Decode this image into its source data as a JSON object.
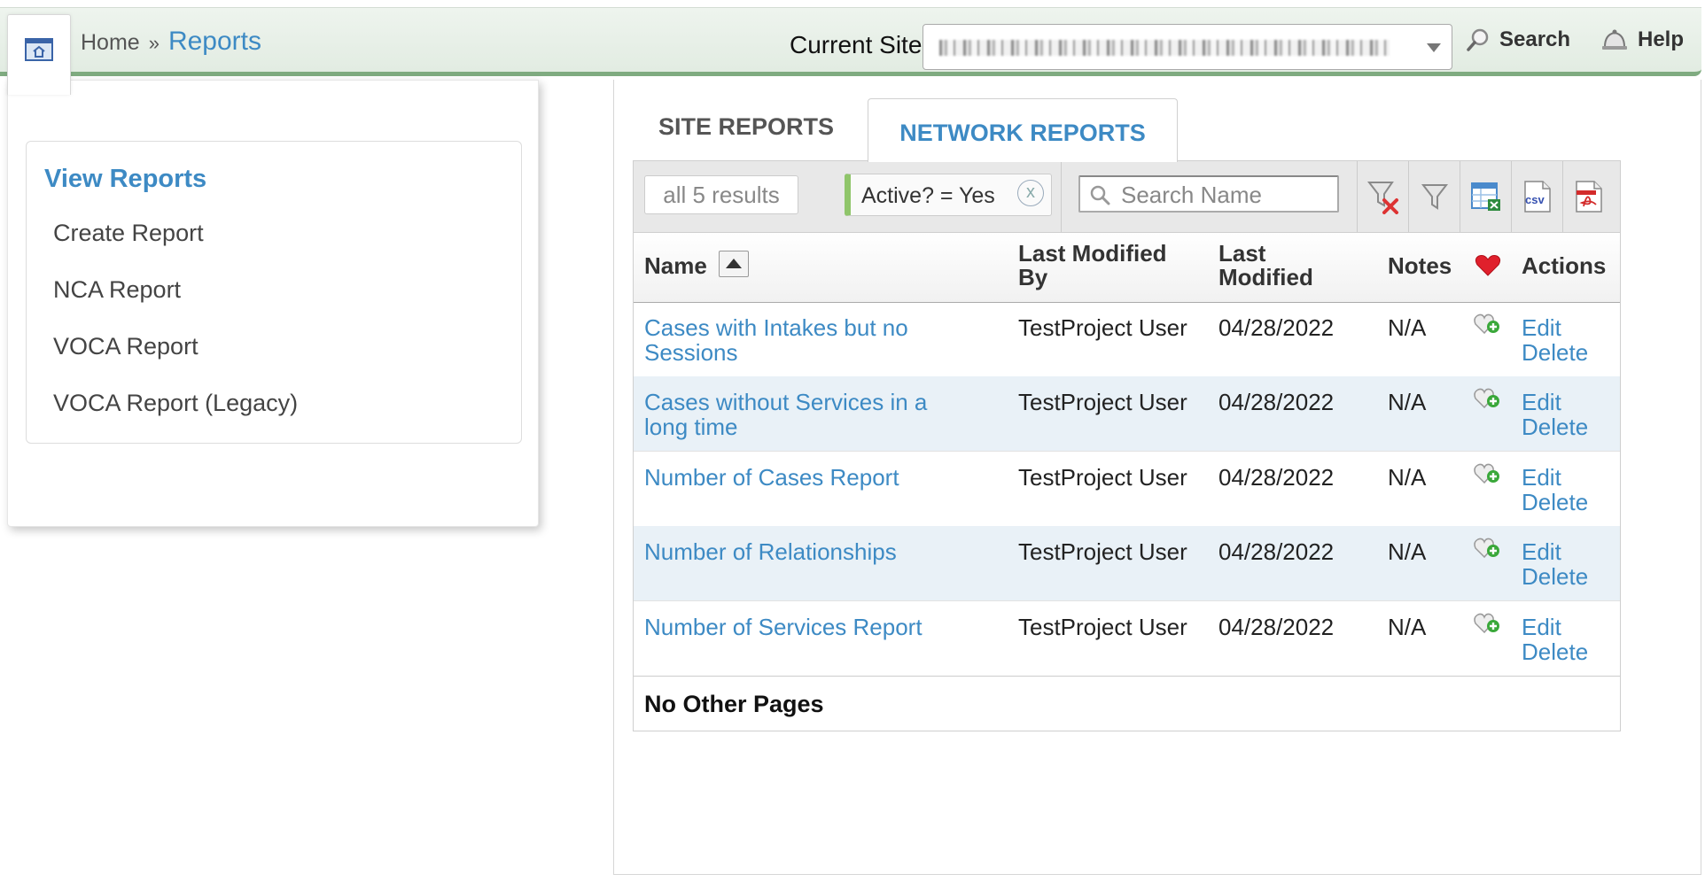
{
  "header": {
    "breadcrumb": {
      "home": "Home",
      "separator": "»",
      "current": "Reports"
    },
    "site_label": "Current Site",
    "site_value": "",
    "search_label": "Search",
    "help_label": "Help"
  },
  "sidebar": {
    "title": "View Reports",
    "items": [
      {
        "label": "Create Report"
      },
      {
        "label": "NCA Report"
      },
      {
        "label": "VOCA Report"
      },
      {
        "label": "VOCA Report (Legacy)"
      }
    ]
  },
  "tabs": [
    {
      "label": "SITE REPORTS",
      "active": false
    },
    {
      "label": "NETWORK REPORTS",
      "active": true
    }
  ],
  "toolbar": {
    "results": "all 5 results",
    "filter_chip": "Active? = Yes",
    "chip_remove": "x",
    "search_placeholder": "Search Name",
    "buttons": [
      "clear-filter-icon",
      "filter-icon",
      "excel-export-icon",
      "csv-export-icon",
      "pdf-export-icon"
    ]
  },
  "table": {
    "columns": {
      "name": "Name",
      "last_modified_by": [
        "Last Modified",
        "By"
      ],
      "last_modified": [
        "Last",
        "Modified"
      ],
      "notes": "Notes",
      "actions": "Actions"
    },
    "rows": [
      {
        "name": [
          "Cases with Intakes but no",
          "Sessions"
        ],
        "by": "TestProject User",
        "date": "04/28/2022",
        "notes": "N/A",
        "edit": "Edit",
        "delete": "Delete"
      },
      {
        "name": [
          "Cases without Services in a",
          "long time"
        ],
        "by": "TestProject User",
        "date": "04/28/2022",
        "notes": "N/A",
        "edit": "Edit",
        "delete": "Delete"
      },
      {
        "name": [
          "Number of Cases Report"
        ],
        "by": "TestProject User",
        "date": "04/28/2022",
        "notes": "N/A",
        "edit": "Edit",
        "delete": "Delete"
      },
      {
        "name": [
          "Number of Relationships"
        ],
        "by": "TestProject User",
        "date": "04/28/2022",
        "notes": "N/A",
        "edit": "Edit",
        "delete": "Delete"
      },
      {
        "name": [
          "Number of Services Report"
        ],
        "by": "TestProject User",
        "date": "04/28/2022",
        "notes": "N/A",
        "edit": "Edit",
        "delete": "Delete"
      }
    ],
    "footer": "No Other Pages"
  },
  "colors": {
    "accent": "#3d8ac4",
    "header_border": "#7fab80",
    "row_alt": "#e9f1f7",
    "chip_accent": "#8fc56a"
  }
}
